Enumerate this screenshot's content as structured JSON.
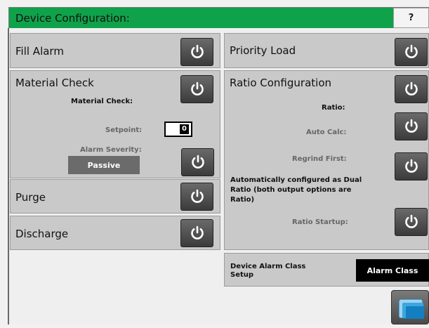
{
  "header": {
    "title": "Device Configuration:",
    "help_label": "?"
  },
  "left": {
    "fill_alarm": {
      "title": "Fill Alarm"
    },
    "material_check": {
      "title": "Material Check",
      "sub_label": "Material Check:",
      "setpoint_label": "Setpoint:",
      "setpoint_value": "0",
      "severity_label": "Alarm Severity:",
      "severity_value": "Passive"
    },
    "purge": {
      "title": "Purge"
    },
    "discharge": {
      "title": "Discharge"
    }
  },
  "right": {
    "priority_load": {
      "title": "Priority Load"
    },
    "ratio_config": {
      "title": "Ratio Configuration",
      "ratio_label": "Ratio:",
      "auto_calc_label": "Auto Calc:",
      "regrind_first_label": "Regrind First:",
      "info_text": "Automatically configured as Dual Ratio (both output options are Ratio)",
      "ratio_startup_label": "Ratio Startup:"
    },
    "alarm_class": {
      "label": "Device Alarm Class Setup",
      "button_label": "Alarm Class"
    }
  },
  "icons": {
    "power": "power-icon",
    "folder": "folder-icon"
  },
  "colors": {
    "header_green": "#0fa24a",
    "panel_grey": "#c9c9c9",
    "button_dark": "#3b3b3b"
  }
}
